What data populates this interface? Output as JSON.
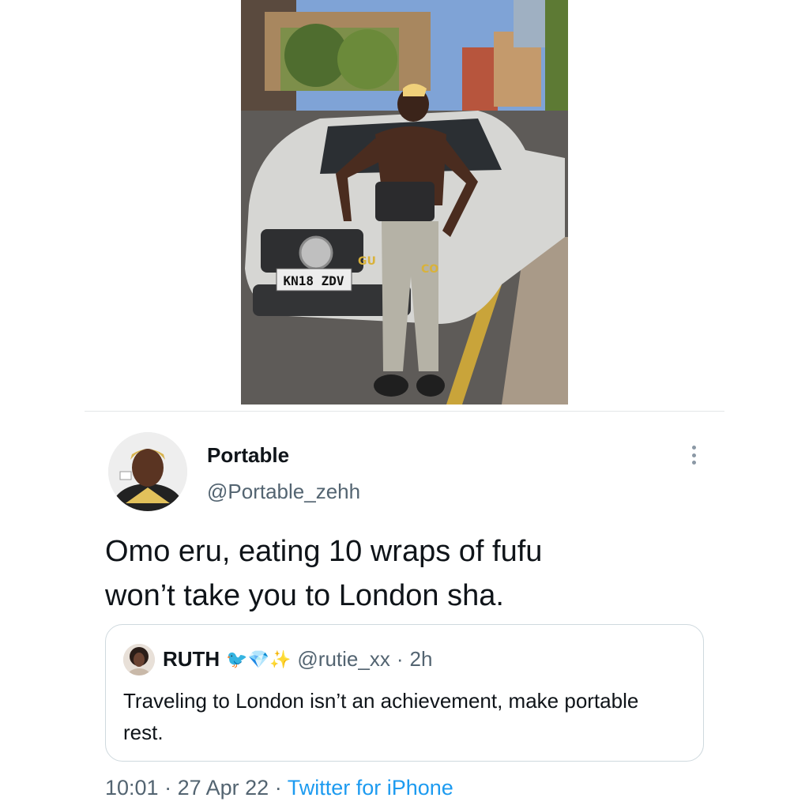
{
  "photo": {
    "alt": "",
    "plate_text": "KN18 ZDV"
  },
  "tweet": {
    "display_name": "Portable",
    "handle": "@Portable_zehh",
    "text": "Omo eru, eating 10 wraps of fufu\nwon’t take you to London sha.",
    "time": "10:01",
    "date": "27 Apr 22",
    "separator": "·",
    "source": "Twitter for iPhone"
  },
  "quote": {
    "name": "RUTH",
    "emojis": "🐦💎✨",
    "handle": "@rutie_xx",
    "separator": "·",
    "time": "2h",
    "text": "Traveling to London isn’t an achievement, make portable rest."
  },
  "icons": {
    "more": "more-vertical-icon",
    "avatar": "avatar-portable",
    "quote_avatar": "avatar-ruth"
  },
  "colors": {
    "text": "#0f1419",
    "secondary": "#536471",
    "link": "#1d9bf0",
    "border": "#cfd9de"
  }
}
